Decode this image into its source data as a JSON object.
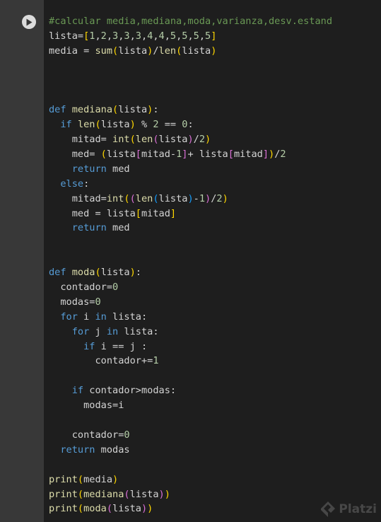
{
  "cell": {
    "run_button_icon": "play-icon",
    "code_lines": [
      [
        [
          "cm",
          "#calcular media,mediana,moda,varianza,desv.estand"
        ]
      ],
      [
        [
          "tx",
          "lista="
        ],
        [
          "b1",
          "["
        ],
        [
          "nm",
          "1"
        ],
        [
          "tx",
          ","
        ],
        [
          "nm",
          "2"
        ],
        [
          "tx",
          ","
        ],
        [
          "nm",
          "3"
        ],
        [
          "tx",
          ","
        ],
        [
          "nm",
          "3"
        ],
        [
          "tx",
          ","
        ],
        [
          "nm",
          "3"
        ],
        [
          "tx",
          ","
        ],
        [
          "nm",
          "4"
        ],
        [
          "tx",
          ","
        ],
        [
          "nm",
          "4"
        ],
        [
          "tx",
          ","
        ],
        [
          "nm",
          "5"
        ],
        [
          "tx",
          ","
        ],
        [
          "nm",
          "5"
        ],
        [
          "tx",
          ","
        ],
        [
          "nm",
          "5"
        ],
        [
          "tx",
          ","
        ],
        [
          "nm",
          "5"
        ],
        [
          "b1",
          "]"
        ]
      ],
      [
        [
          "tx",
          "media = "
        ],
        [
          "fn",
          "sum"
        ],
        [
          "b1",
          "("
        ],
        [
          "tx",
          "lista"
        ],
        [
          "b1",
          ")"
        ],
        [
          "tx",
          "/"
        ],
        [
          "fn",
          "len"
        ],
        [
          "b1",
          "("
        ],
        [
          "tx",
          "lista"
        ],
        [
          "b1",
          ")"
        ]
      ],
      [],
      [],
      [],
      [
        [
          "kw",
          "def"
        ],
        [
          "tx",
          " "
        ],
        [
          "fn",
          "mediana"
        ],
        [
          "b1",
          "("
        ],
        [
          "tx",
          "lista"
        ],
        [
          "b1",
          ")"
        ],
        [
          "tx",
          ":"
        ]
      ],
      [
        [
          "tx",
          "  "
        ],
        [
          "kw",
          "if"
        ],
        [
          "tx",
          " "
        ],
        [
          "fn",
          "len"
        ],
        [
          "b1",
          "("
        ],
        [
          "tx",
          "lista"
        ],
        [
          "b1",
          ")"
        ],
        [
          "tx",
          " % "
        ],
        [
          "nm",
          "2"
        ],
        [
          "tx",
          " == "
        ],
        [
          "nm",
          "0"
        ],
        [
          "tx",
          ":"
        ]
      ],
      [
        [
          "tx",
          "    mitad= "
        ],
        [
          "fn",
          "int"
        ],
        [
          "b1",
          "("
        ],
        [
          "fn",
          "len"
        ],
        [
          "b2",
          "("
        ],
        [
          "tx",
          "lista"
        ],
        [
          "b2",
          ")"
        ],
        [
          "tx",
          "/"
        ],
        [
          "nm",
          "2"
        ],
        [
          "b1",
          ")"
        ]
      ],
      [
        [
          "tx",
          "    med= "
        ],
        [
          "b1",
          "("
        ],
        [
          "tx",
          "lista"
        ],
        [
          "b2",
          "["
        ],
        [
          "tx",
          "mitad-"
        ],
        [
          "nm",
          "1"
        ],
        [
          "b2",
          "]"
        ],
        [
          "tx",
          "+ lista"
        ],
        [
          "b2",
          "["
        ],
        [
          "tx",
          "mitad"
        ],
        [
          "b2",
          "]"
        ],
        [
          "b1",
          ")"
        ],
        [
          "tx",
          "/"
        ],
        [
          "nm",
          "2"
        ]
      ],
      [
        [
          "tx",
          "    "
        ],
        [
          "kw",
          "return"
        ],
        [
          "tx",
          " med"
        ]
      ],
      [
        [
          "tx",
          "  "
        ],
        [
          "kw",
          "else"
        ],
        [
          "tx",
          ":"
        ]
      ],
      [
        [
          "tx",
          "    mitad="
        ],
        [
          "fn",
          "int"
        ],
        [
          "b1",
          "("
        ],
        [
          "b2",
          "("
        ],
        [
          "fn",
          "len"
        ],
        [
          "b3",
          "("
        ],
        [
          "tx",
          "lista"
        ],
        [
          "b3",
          ")"
        ],
        [
          "tx",
          "-"
        ],
        [
          "nm",
          "1"
        ],
        [
          "b2",
          ")"
        ],
        [
          "tx",
          "/"
        ],
        [
          "nm",
          "2"
        ],
        [
          "b1",
          ")"
        ]
      ],
      [
        [
          "tx",
          "    med = lista"
        ],
        [
          "b1",
          "["
        ],
        [
          "tx",
          "mitad"
        ],
        [
          "b1",
          "]"
        ]
      ],
      [
        [
          "tx",
          "    "
        ],
        [
          "kw",
          "return"
        ],
        [
          "tx",
          " med"
        ]
      ],
      [],
      [],
      [
        [
          "kw",
          "def"
        ],
        [
          "tx",
          " "
        ],
        [
          "fn",
          "moda"
        ],
        [
          "b1",
          "("
        ],
        [
          "tx",
          "lista"
        ],
        [
          "b1",
          ")"
        ],
        [
          "tx",
          ":"
        ]
      ],
      [
        [
          "tx",
          "  contador="
        ],
        [
          "nm",
          "0"
        ]
      ],
      [
        [
          "tx",
          "  modas="
        ],
        [
          "nm",
          "0"
        ]
      ],
      [
        [
          "tx",
          "  "
        ],
        [
          "kw",
          "for"
        ],
        [
          "tx",
          " i "
        ],
        [
          "kw",
          "in"
        ],
        [
          "tx",
          " lista:"
        ]
      ],
      [
        [
          "tx",
          "    "
        ],
        [
          "kw",
          "for"
        ],
        [
          "tx",
          " j "
        ],
        [
          "kw",
          "in"
        ],
        [
          "tx",
          " lista:"
        ]
      ],
      [
        [
          "tx",
          "      "
        ],
        [
          "kw",
          "if"
        ],
        [
          "tx",
          " i == j :"
        ]
      ],
      [
        [
          "tx",
          "        contador+="
        ],
        [
          "nm",
          "1"
        ]
      ],
      [],
      [
        [
          "tx",
          "    "
        ],
        [
          "kw",
          "if"
        ],
        [
          "tx",
          " contador>modas:"
        ]
      ],
      [
        [
          "tx",
          "      modas=i"
        ]
      ],
      [],
      [
        [
          "tx",
          "    contador="
        ],
        [
          "nm",
          "0"
        ]
      ],
      [
        [
          "tx",
          "  "
        ],
        [
          "kw",
          "return"
        ],
        [
          "tx",
          " modas"
        ]
      ],
      [],
      [
        [
          "fn",
          "print"
        ],
        [
          "b1",
          "("
        ],
        [
          "tx",
          "media"
        ],
        [
          "b1",
          ")"
        ]
      ],
      [
        [
          "fn",
          "print"
        ],
        [
          "b1",
          "("
        ],
        [
          "fn",
          "mediana"
        ],
        [
          "b2",
          "("
        ],
        [
          "tx",
          "lista"
        ],
        [
          "b2",
          ")"
        ],
        [
          "b1",
          ")"
        ]
      ],
      [
        [
          "fn",
          "print"
        ],
        [
          "b1",
          "("
        ],
        [
          "fn",
          "moda"
        ],
        [
          "b2",
          "("
        ],
        [
          "tx",
          "lista"
        ],
        [
          "b2",
          ")"
        ],
        [
          "b1",
          ")"
        ]
      ]
    ]
  },
  "watermark": {
    "text": "Platzi",
    "icon": "platzi-logo-icon"
  }
}
